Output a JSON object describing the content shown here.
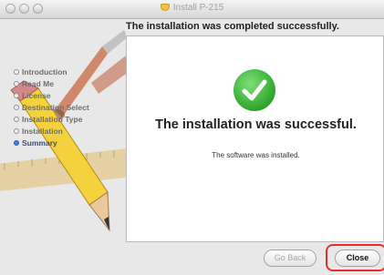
{
  "window": {
    "title": "Install P-215",
    "title_icon": "installer-box-icon"
  },
  "header": {
    "text": "The installation was completed successfully."
  },
  "sidebar": {
    "steps": [
      {
        "label": "Introduction",
        "current": false
      },
      {
        "label": "Read Me",
        "current": false
      },
      {
        "label": "License",
        "current": false
      },
      {
        "label": "Destination Select",
        "current": false
      },
      {
        "label": "Installation Type",
        "current": false
      },
      {
        "label": "Installation",
        "current": false
      },
      {
        "label": "Summary",
        "current": true
      }
    ]
  },
  "main": {
    "status_icon": "green-checkmark-icon",
    "headline": "The installation was successful.",
    "subtext": "The software was installed."
  },
  "buttons": {
    "back_label": "Go Back",
    "close_label": "Close"
  },
  "colors": {
    "success_green": "#2ea52b",
    "highlight_red": "#e42d2d",
    "current_step": "#4a7bd8"
  }
}
